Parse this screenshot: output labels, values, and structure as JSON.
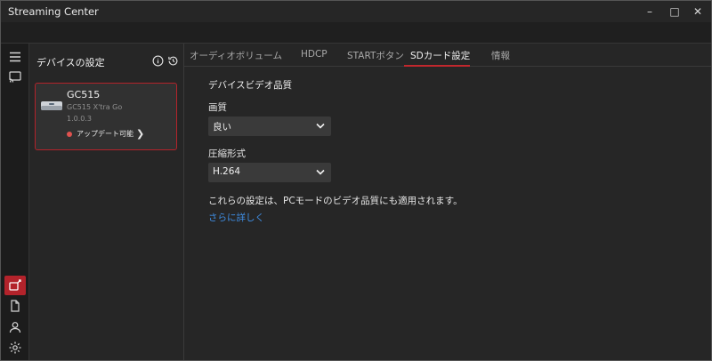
{
  "window": {
    "title": "Streaming Center",
    "controls": {
      "minimize": "–",
      "maximize": "□",
      "close": "✕"
    }
  },
  "rail": {
    "icons": [
      "menu-icon",
      "cast-icon",
      "device-settings-icon",
      "document-icon",
      "user-icon",
      "gear-icon"
    ],
    "active_color": "#b3232b"
  },
  "device_panel": {
    "title": "デバイスの設定",
    "device": {
      "name": "GC515",
      "model": "GC515 X'tra Go",
      "version": "1.0.0.3",
      "update_status": "アップデート可能",
      "status_color": "#e0524f"
    }
  },
  "tabs": [
    {
      "label": "オーディオボリューム",
      "active": false
    },
    {
      "label": "HDCP",
      "active": false
    },
    {
      "label": "STARTボタン",
      "active": false
    },
    {
      "label": "SDカード設定",
      "active": true
    },
    {
      "label": "情報",
      "active": false
    }
  ],
  "content": {
    "section_title": "デバイスビデオ品質",
    "quality": {
      "label": "画質",
      "value": "良い"
    },
    "compression": {
      "label": "圧縮形式",
      "value": "H.264"
    },
    "note": "これらの設定は、PCモードのビデオ品質にも適用されます。",
    "more_link": "さらに詳しく",
    "accent_color": "#c1272d",
    "link_color": "#3f8fe6"
  }
}
